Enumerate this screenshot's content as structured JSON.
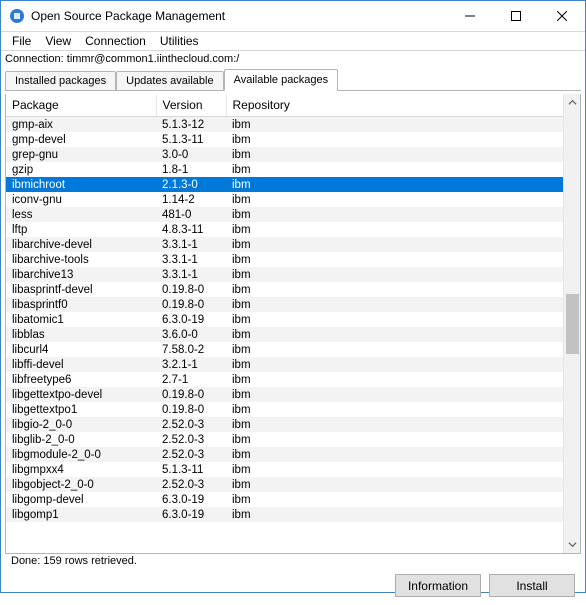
{
  "window": {
    "title": "Open Source Package Management"
  },
  "menu": {
    "file": "File",
    "view": "View",
    "connection": "Connection",
    "utilities": "Utilities"
  },
  "connection_label": "Connection: timmr@common1.iinthecloud.com:/",
  "tabs": {
    "installed": "Installed packages",
    "updates": "Updates available",
    "available": "Available packages"
  },
  "columns": {
    "package": "Package",
    "version": "Version",
    "repository": "Repository"
  },
  "rows": [
    {
      "pkg": "gmp-aix",
      "ver": "5.1.3-12",
      "repo": "ibm"
    },
    {
      "pkg": "gmp-devel",
      "ver": "5.1.3-11",
      "repo": "ibm"
    },
    {
      "pkg": "grep-gnu",
      "ver": "3.0-0",
      "repo": "ibm"
    },
    {
      "pkg": "gzip",
      "ver": "1.8-1",
      "repo": "ibm"
    },
    {
      "pkg": "ibmichroot",
      "ver": "2.1.3-0",
      "repo": "ibm",
      "selected": true
    },
    {
      "pkg": "iconv-gnu",
      "ver": "1.14-2",
      "repo": "ibm"
    },
    {
      "pkg": "less",
      "ver": "481-0",
      "repo": "ibm"
    },
    {
      "pkg": "lftp",
      "ver": "4.8.3-11",
      "repo": "ibm"
    },
    {
      "pkg": "libarchive-devel",
      "ver": "3.3.1-1",
      "repo": "ibm"
    },
    {
      "pkg": "libarchive-tools",
      "ver": "3.3.1-1",
      "repo": "ibm"
    },
    {
      "pkg": "libarchive13",
      "ver": "3.3.1-1",
      "repo": "ibm"
    },
    {
      "pkg": "libasprintf-devel",
      "ver": "0.19.8-0",
      "repo": "ibm"
    },
    {
      "pkg": "libasprintf0",
      "ver": "0.19.8-0",
      "repo": "ibm"
    },
    {
      "pkg": "libatomic1",
      "ver": "6.3.0-19",
      "repo": "ibm"
    },
    {
      "pkg": "libblas",
      "ver": "3.6.0-0",
      "repo": "ibm"
    },
    {
      "pkg": "libcurl4",
      "ver": "7.58.0-2",
      "repo": "ibm"
    },
    {
      "pkg": "libffi-devel",
      "ver": "3.2.1-1",
      "repo": "ibm"
    },
    {
      "pkg": "libfreetype6",
      "ver": "2.7-1",
      "repo": "ibm"
    },
    {
      "pkg": "libgettextpo-devel",
      "ver": "0.19.8-0",
      "repo": "ibm"
    },
    {
      "pkg": "libgettextpo1",
      "ver": "0.19.8-0",
      "repo": "ibm"
    },
    {
      "pkg": "libgio-2_0-0",
      "ver": "2.52.0-3",
      "repo": "ibm"
    },
    {
      "pkg": "libglib-2_0-0",
      "ver": "2.52.0-3",
      "repo": "ibm"
    },
    {
      "pkg": "libgmodule-2_0-0",
      "ver": "2.52.0-3",
      "repo": "ibm"
    },
    {
      "pkg": "libgmpxx4",
      "ver": "5.1.3-11",
      "repo": "ibm"
    },
    {
      "pkg": "libgobject-2_0-0",
      "ver": "2.52.0-3",
      "repo": "ibm"
    },
    {
      "pkg": "libgomp-devel",
      "ver": "6.3.0-19",
      "repo": "ibm"
    },
    {
      "pkg": "libgomp1",
      "ver": "6.3.0-19",
      "repo": "ibm"
    }
  ],
  "status": "Done: 159 rows retrieved.",
  "buttons": {
    "information": "Information",
    "install": "Install"
  }
}
